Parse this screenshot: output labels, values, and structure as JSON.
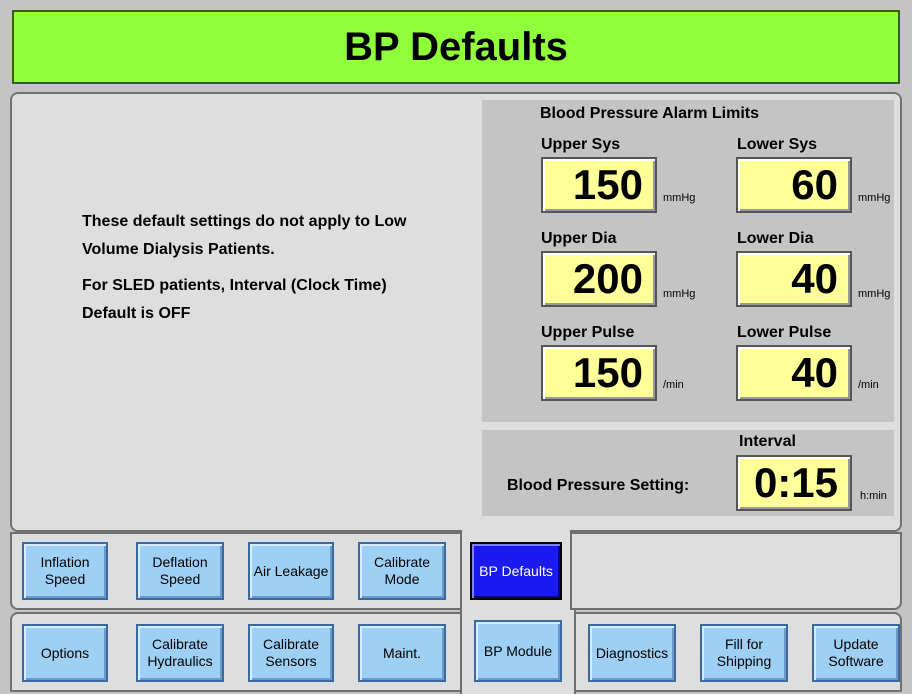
{
  "title": "BP Defaults",
  "note": {
    "line1": "These default settings do not apply to Low Volume Dialysis Patients.",
    "line2": "For SLED patients, Interval (Clock Time) Default is OFF"
  },
  "alarm_limits": {
    "title": "Blood Pressure Alarm Limits",
    "upper_sys": {
      "label": "Upper Sys",
      "value": "150",
      "unit": "mmHg"
    },
    "lower_sys": {
      "label": "Lower Sys",
      "value": "60",
      "unit": "mmHg"
    },
    "upper_dia": {
      "label": "Upper Dia",
      "value": "200",
      "unit": "mmHg"
    },
    "lower_dia": {
      "label": "Lower Dia",
      "value": "40",
      "unit": "mmHg"
    },
    "upper_pulse": {
      "label": "Upper Pulse",
      "value": "150",
      "unit": "/min"
    },
    "lower_pulse": {
      "label": "Lower Pulse",
      "value": "40",
      "unit": "/min"
    }
  },
  "interval": {
    "label": "Interval",
    "setting_label": "Blood Pressure Setting:",
    "value": "0:15",
    "unit": "h:min"
  },
  "tabs_row1": [
    {
      "label": "Inflation Speed"
    },
    {
      "label": "Deflation Speed"
    },
    {
      "label": "Air Leakage"
    },
    {
      "label": "Calibrate Mode"
    },
    {
      "label": "BP Defaults",
      "active": true
    }
  ],
  "tabs_row2": [
    {
      "label": "Options"
    },
    {
      "label": "Calibrate Hydraulics"
    },
    {
      "label": "Calibrate Sensors"
    },
    {
      "label": "Maint."
    },
    {
      "label": "BP Module",
      "active_group": true
    },
    {
      "label": "Diagnostics"
    },
    {
      "label": "Fill for Shipping"
    },
    {
      "label": "Update Software"
    }
  ],
  "colors": {
    "title_bar": "#8eff3a",
    "value_box": "#ffff99",
    "button": "#9ecff5",
    "active_button": "#1a1aee"
  }
}
